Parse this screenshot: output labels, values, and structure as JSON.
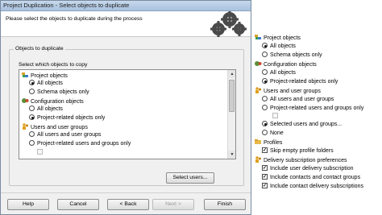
{
  "dialog": {
    "title": "Project Duplication - Select objects to duplicate",
    "description": "Please select the objects to duplicate during the process",
    "group_label": "Objects to duplicate",
    "which_label": "Select which objects to copy",
    "select_users_button": "Select users..."
  },
  "list": {
    "project_objects": "Project objects",
    "all_objects": "All objects",
    "schema_objects_only": "Schema objects only",
    "configuration_objects": "Configuration objects",
    "config_all_objects": "All objects",
    "project_related_objects_only": "Project-related objects only",
    "users_and_user_groups": "Users and user groups",
    "all_users": "All users and user groups",
    "project_related_users": "Project-related users and groups only"
  },
  "footer": {
    "help": "Help",
    "cancel": "Cancel",
    "back": "< Back",
    "next": "Next >",
    "finish": "Finish"
  },
  "right_panel": {
    "project_objects": "Project objects",
    "all_objects": "All objects",
    "schema_objects_only": "Schema objects only",
    "configuration_objects": "Configuration objects",
    "config_all_objects": "All objects",
    "project_related_objects_only": "Project-related objects only",
    "users_and_user_groups": "Users and user groups",
    "all_users": "All users and user groups",
    "project_related_users": "Project-related users and groups only",
    "selected_users": "Selected users and groups...",
    "none": "None",
    "profiles": "Profiles",
    "skip_empty_profile_folders": "Skip empty profile folders",
    "delivery_subscription_preferences": "Delivery subscription preferences",
    "include_user_delivery": "Include user delivery subscription",
    "include_contacts": "Include contacts and contact groups",
    "include_contact_delivery": "Include contact delivery subscriptions"
  },
  "icons": {
    "project": "project-icon",
    "configuration": "configuration-icon",
    "users": "users-icon",
    "profiles": "folder-icon",
    "gears": "gears-icon"
  }
}
